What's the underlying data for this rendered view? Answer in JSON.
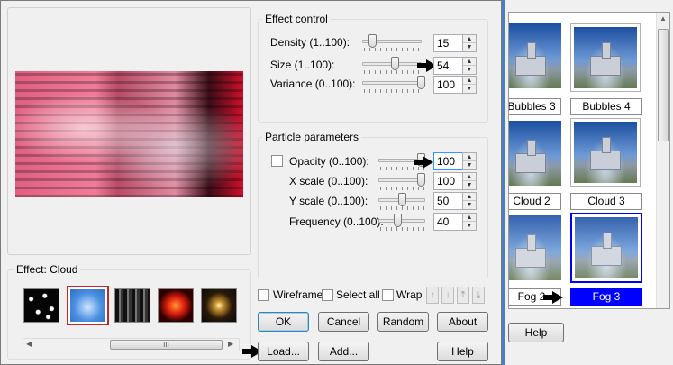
{
  "effect_control": {
    "title": "Effect control",
    "density": {
      "label": "Density (1..100):",
      "value": "15",
      "level": 15
    },
    "size": {
      "label": "Size (1..100):",
      "value": "54",
      "level": 54
    },
    "variance": {
      "label": "Variance (0..100):",
      "value": "100",
      "level": 100
    }
  },
  "particle_parameters": {
    "title": "Particle parameters",
    "opacity": {
      "label": "Opacity (0..100):",
      "value": "100",
      "level": 100,
      "checked": false
    },
    "x_scale": {
      "label": "X scale (0..100):",
      "value": "100",
      "level": 100
    },
    "y_scale": {
      "label": "Y scale (0..100):",
      "value": "50",
      "level": 50
    },
    "frequency": {
      "label": "Frequency (0..100):",
      "value": "40",
      "level": 40
    }
  },
  "effect_panel": {
    "title": "Effect: Cloud",
    "scroll_grip": "III"
  },
  "options": {
    "wireframe": "Wireframe",
    "select_all": "Select all",
    "wrap": "Wrap"
  },
  "buttons": {
    "ok": "OK",
    "cancel": "Cancel",
    "random": "Random",
    "about": "About",
    "load": "Load...",
    "add": "Add...",
    "help": "Help"
  },
  "gallery": {
    "items": [
      {
        "caption": "Bubbles 3"
      },
      {
        "caption": "Bubbles 4"
      },
      {
        "caption": "Cloud 2"
      },
      {
        "caption": "Cloud 3"
      },
      {
        "caption": "Fog 2"
      },
      {
        "caption": "Fog 3",
        "selected": true
      }
    ],
    "help": "Help"
  },
  "colors": {
    "selection": "#0000ff",
    "thumb_selected_border": "#c0282a"
  },
  "arrows": [
    "size-arrow",
    "opacity-arrow",
    "load-arrow",
    "fog-arrow"
  ]
}
